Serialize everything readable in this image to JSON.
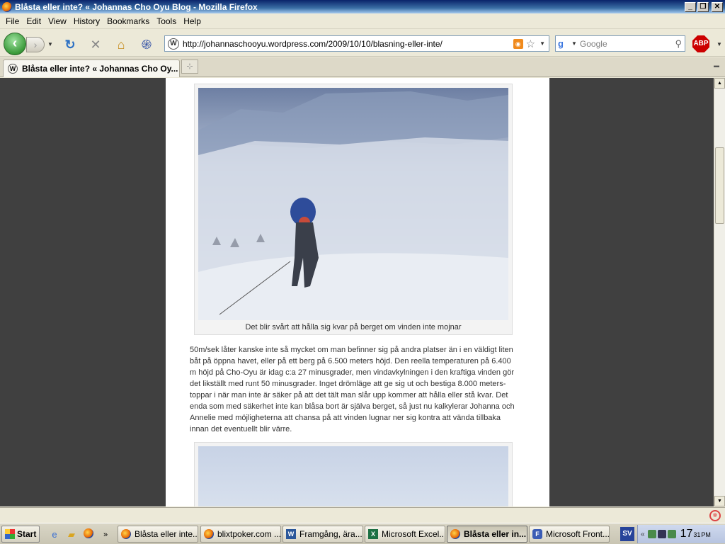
{
  "window": {
    "title": "Blåsta eller inte? « Johannas Cho Oyu Blog - Mozilla Firefox",
    "controls": [
      "_",
      "❐",
      "✕"
    ]
  },
  "menu": [
    "File",
    "Edit",
    "View",
    "History",
    "Bookmarks",
    "Tools",
    "Help"
  ],
  "nav": {
    "url": "http://johannaschooyu.wordpress.com/2009/10/10/blasning-eller-inte/",
    "search_placeholder": "Google",
    "abp_label": "ABP"
  },
  "tabs": [
    {
      "label": "Blåsta eller inte? « Johannas Cho Oy..."
    }
  ],
  "content": {
    "figure1_caption": "Det blir svårt att hålla sig kvar på berget om vinden inte mojnar",
    "paragraph": "50m/sek låter kanske inte så mycket om man befinner sig på andra platser än i en väldigt liten båt på öppna havet, eller på ett berg på 6.500 meters höjd. Den reella temperaturen på  6.400 m höjd på Cho-Oyu är idag c:a 27 minusgrader, men vindavkylningen i den kraftiga vinden gör det likställt med runt 50 minusgrader. Inget drömläge att ge sig ut och bestiga 8.000 meters-toppar i när man inte är säker på att det tält man slår upp kommer att hålla eller stå kvar. Det enda som med säkerhet inte kan blåsa bort är själva berget, så just nu kalkylerar Johanna och Annelie med möjligheterna att chansa på att vinden lugnar ner sig kontra att vända tillbaka innan det eventuellt blir värre."
  },
  "taskbar": {
    "start_label": "Start",
    "buttons": [
      {
        "label": "Blåsta eller inte...",
        "icon": "firefox-icon"
      },
      {
        "label": "blixtpoker.com ...",
        "icon": "firefox-icon"
      },
      {
        "label": "Framgång, ära...",
        "icon": "word-icon"
      },
      {
        "label": "Microsoft Excel...",
        "icon": "excel-icon"
      },
      {
        "label": "Blåsta eller in...",
        "icon": "firefox-icon"
      },
      {
        "label": "Microsoft Front...",
        "icon": "frontpage-icon"
      }
    ],
    "language": "SV",
    "clock_hour": "17",
    "clock_min": "31",
    "clock_ampm": "PM"
  }
}
